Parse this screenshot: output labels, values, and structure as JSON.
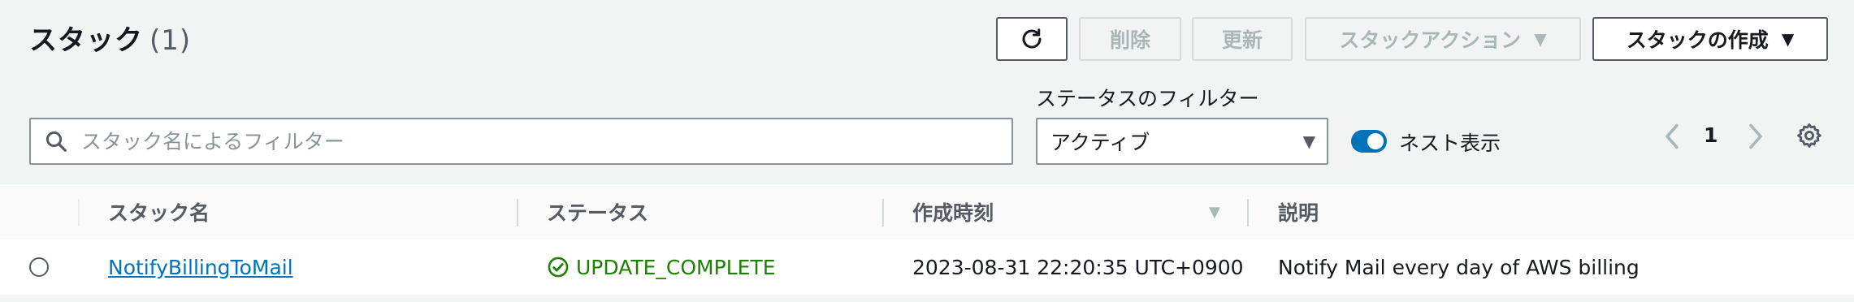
{
  "header": {
    "title": "スタック",
    "count": "(1)"
  },
  "toolbar": {
    "refresh_icon": "refresh-icon",
    "delete_label": "削除",
    "update_label": "更新",
    "stack_actions_label": "スタックアクション",
    "create_stack_label": "スタックの作成"
  },
  "filters": {
    "search_placeholder": "スタック名によるフィルター",
    "search_value": "",
    "status_filter_label": "ステータスのフィルター",
    "status_selected": "アクティブ",
    "nested_toggle_label": "ネスト表示",
    "nested_toggle_on": true
  },
  "pagination": {
    "current_page": "1"
  },
  "table": {
    "columns": [
      "スタック名",
      "ステータス",
      "作成時刻",
      "説明"
    ],
    "sorted_column": "作成時刻",
    "sort_direction": "descending",
    "rows": [
      {
        "name": "NotifyBillingToMail",
        "status": "UPDATE_COMPLETE",
        "created": "2023-08-31 22:20:35 UTC+0900",
        "description": "Notify Mail every day of AWS billing"
      }
    ]
  },
  "colors": {
    "accent": "#0073bb",
    "success": "#1d8102",
    "background": "#f2f3f3"
  }
}
